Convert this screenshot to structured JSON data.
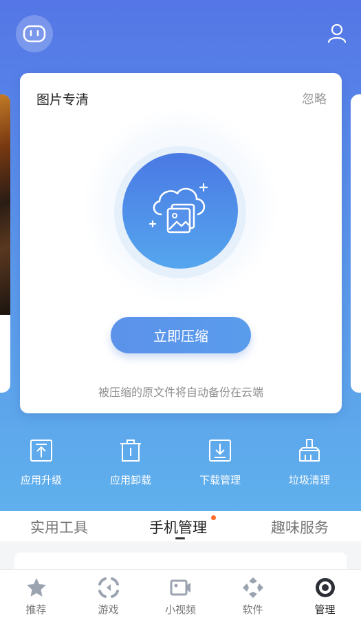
{
  "header": {
    "robot_icon": "robot-face-icon",
    "user_icon": "user-icon"
  },
  "card": {
    "title": "图片专清",
    "ignore_label": "忽略",
    "illustration_icon": "cloud-photo-icon",
    "action_label": "立即压缩",
    "hint": "被压缩的原文件将自动备份在云端"
  },
  "tools": [
    {
      "label": "应用升级",
      "icon": "app-upgrade-icon"
    },
    {
      "label": "应用卸载",
      "icon": "trash-icon"
    },
    {
      "label": "下载管理",
      "icon": "download-icon"
    },
    {
      "label": "垃圾清理",
      "icon": "broom-icon"
    }
  ],
  "tabs": [
    {
      "label": "实用工具",
      "active": false
    },
    {
      "label": "手机管理",
      "active": true,
      "badge_dot": true
    },
    {
      "label": "趣味服务",
      "active": false
    }
  ],
  "bottom_nav": [
    {
      "label": "推荐",
      "icon": "star-icon",
      "active": false
    },
    {
      "label": "游戏",
      "icon": "game-icon",
      "active": false
    },
    {
      "label": "小视频",
      "icon": "video-icon",
      "active": false
    },
    {
      "label": "软件",
      "icon": "diamond-icon",
      "active": false
    },
    {
      "label": "管理",
      "icon": "manage-icon",
      "active": true
    }
  ],
  "colors": {
    "gradient_top": "#5476e6",
    "gradient_bottom": "#5fb0ec",
    "accent_button": "#5b92ea",
    "badge_dot": "#ff6a2a"
  }
}
